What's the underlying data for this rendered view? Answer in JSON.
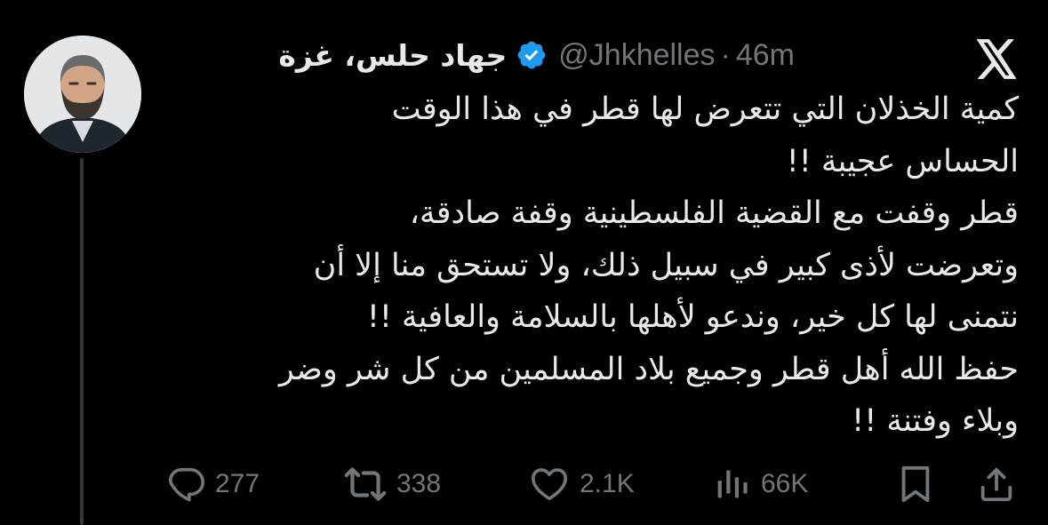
{
  "tweet": {
    "author": {
      "display_name": "جهاد حلس، غزة",
      "handle": "@Jhkhelles",
      "separator": "·",
      "time": "46m",
      "verified": true,
      "avatar_icon": "profile-photo"
    },
    "body_lines": [
      "كمية الخذلان التي تتعرض لها قطر في هذا الوقت",
      "الحساس عجيبة !!",
      "قطر وقفت مع القضية الفلسطينية وقفة صادقة،",
      "وتعرضت لأذى كبير في سبيل ذلك، ولا تستحق منا إلا أن",
      "نتمنى لها كل خير، وندعو لأهلها بالسلامة والعافية !!",
      "حفظ الله أهل قطر وجميع بلاد المسلمين من كل شر وضر",
      "وبلاء وفتنة !!"
    ],
    "actions": {
      "replies": {
        "icon": "reply-icon",
        "count": "277"
      },
      "reposts": {
        "icon": "repost-icon",
        "count": "338"
      },
      "likes": {
        "icon": "like-icon",
        "count": "2.1K"
      },
      "views": {
        "icon": "views-icon",
        "count": "66K"
      },
      "bookmark": {
        "icon": "bookmark-icon"
      },
      "share": {
        "icon": "share-icon"
      }
    }
  },
  "brand": {
    "logo_icon": "x-logo"
  },
  "colors": {
    "background": "#000000",
    "text": "#e7e9ea",
    "secondary_text": "#71767b",
    "verified_badge": "#1d9bf0",
    "thread_line": "#333639"
  }
}
